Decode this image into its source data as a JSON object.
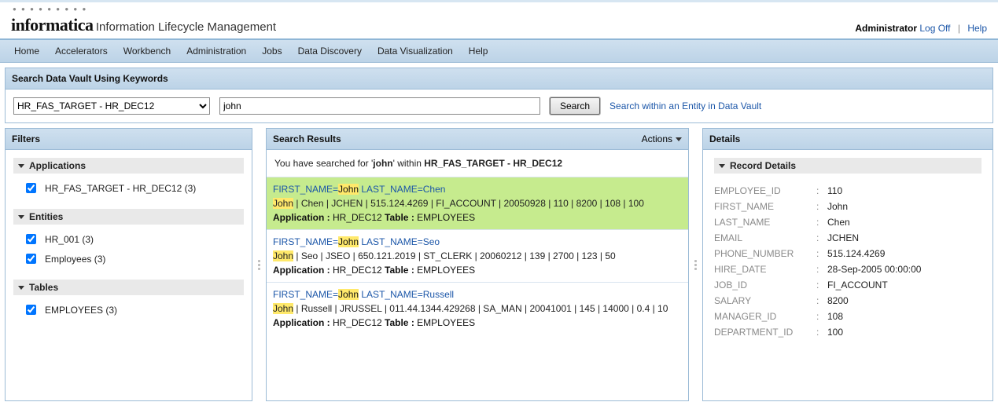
{
  "header": {
    "logo": "informatica",
    "tagline": "Information Lifecycle Management",
    "user": "Administrator",
    "logoff": "Log Off",
    "help": "Help"
  },
  "menu": [
    "Home",
    "Accelerators",
    "Workbench",
    "Administration",
    "Jobs",
    "Data Discovery",
    "Data Visualization",
    "Help"
  ],
  "search_panel": {
    "title": "Search Data Vault Using Keywords",
    "dropdown_selected": "HR_FAS_TARGET - HR_DEC12",
    "query": "john",
    "button": "Search",
    "within_link": "Search within an Entity in Data Vault"
  },
  "filters": {
    "title": "Filters",
    "groups": [
      {
        "label": "Applications",
        "items": [
          {
            "label": "HR_FAS_TARGET - HR_DEC12 (3)",
            "checked": true
          }
        ]
      },
      {
        "label": "Entities",
        "items": [
          {
            "label": "HR_001 (3)",
            "checked": true
          },
          {
            "label": "Employees (3)",
            "checked": true
          }
        ]
      },
      {
        "label": "Tables",
        "items": [
          {
            "label": "EMPLOYEES (3)",
            "checked": true
          }
        ]
      }
    ]
  },
  "results": {
    "title": "Search Results",
    "actions_label": "Actions",
    "summary_prefix": "You have searched for '",
    "summary_term": "john",
    "summary_mid": "' within ",
    "summary_scope": "HR_FAS_TARGET - HR_DEC12",
    "rows": [
      {
        "selected": true,
        "line1_pre": "FIRST_NAME=",
        "line1_hl": "John",
        "line1_post": " LAST_NAME=Chen",
        "line2_hl": "John",
        "line2_rest": " | Chen | JCHEN | 515.124.4269 | FI_ACCOUNT | 20050928 | 110 | 8200 | 108 | 100",
        "line3_app": "HR_DEC12",
        "line3_table": "EMPLOYEES"
      },
      {
        "selected": false,
        "line1_pre": "FIRST_NAME=",
        "line1_hl": "John",
        "line1_post": " LAST_NAME=Seo",
        "line2_hl": "John",
        "line2_rest": " | Seo | JSEO | 650.121.2019 | ST_CLERK | 20060212 | 139 | 2700 | 123 | 50",
        "line3_app": "HR_DEC12",
        "line3_table": "EMPLOYEES"
      },
      {
        "selected": false,
        "line1_pre": "FIRST_NAME=",
        "line1_hl": "John",
        "line1_post": " LAST_NAME=Russell",
        "line2_hl": "John",
        "line2_rest": " | Russell | JRUSSEL | 011.44.1344.429268 | SA_MAN | 20041001 | 145 | 14000 | 0.4 | 10",
        "line3_app": "HR_DEC12",
        "line3_table": "EMPLOYEES"
      }
    ]
  },
  "details": {
    "title": "Details",
    "section": "Record Details",
    "fields": [
      {
        "k": "EMPLOYEE_ID",
        "v": "110"
      },
      {
        "k": "FIRST_NAME",
        "v": "John"
      },
      {
        "k": "LAST_NAME",
        "v": "Chen"
      },
      {
        "k": "EMAIL",
        "v": "JCHEN"
      },
      {
        "k": "PHONE_NUMBER",
        "v": "515.124.4269"
      },
      {
        "k": "HIRE_DATE",
        "v": "28-Sep-2005 00:00:00"
      },
      {
        "k": "JOB_ID",
        "v": "FI_ACCOUNT"
      },
      {
        "k": "SALARY",
        "v": "8200"
      },
      {
        "k": "MANAGER_ID",
        "v": "108"
      },
      {
        "k": "DEPARTMENT_ID",
        "v": "100"
      }
    ]
  },
  "labels": {
    "application": "Application :",
    "table": "Table :"
  }
}
